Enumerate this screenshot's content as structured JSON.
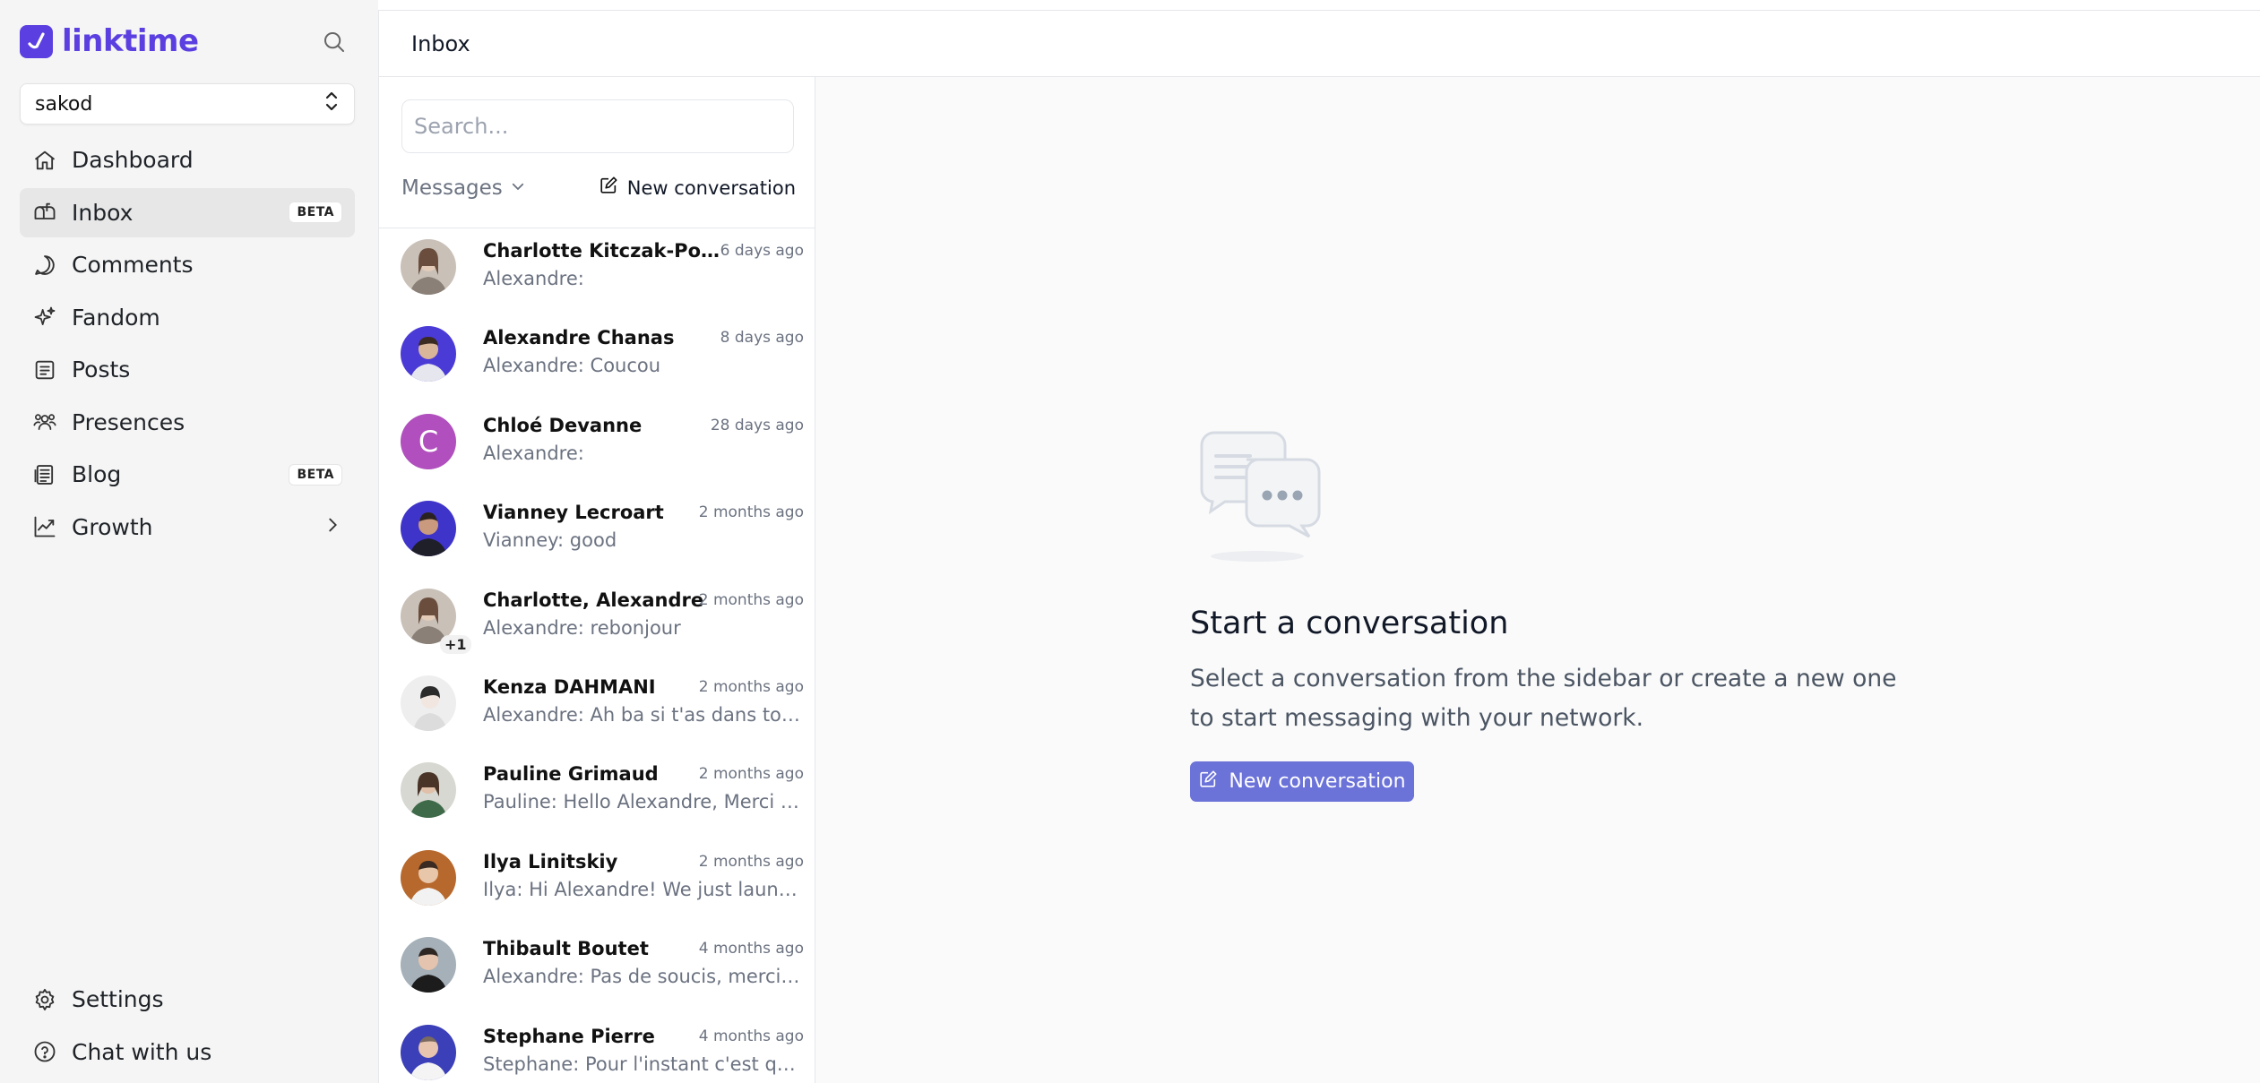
{
  "brand": {
    "name": "linktime",
    "accent": "#5b3fe0"
  },
  "workspace": {
    "selected": "sakod"
  },
  "nav": {
    "items": [
      {
        "label": "Dashboard",
        "icon": "home-icon"
      },
      {
        "label": "Inbox",
        "icon": "mailbox-icon",
        "badge": "BETA",
        "active": true
      },
      {
        "label": "Comments",
        "icon": "chat-bubble-icon"
      },
      {
        "label": "Fandom",
        "icon": "sparkles-icon"
      },
      {
        "label": "Posts",
        "icon": "document-list-icon"
      },
      {
        "label": "Presences",
        "icon": "users-icon"
      },
      {
        "label": "Blog",
        "icon": "newspaper-icon",
        "badge": "BETA"
      },
      {
        "label": "Growth",
        "icon": "trend-chart-icon",
        "has_submenu": true
      }
    ],
    "bottom": [
      {
        "label": "Settings",
        "icon": "gear-icon"
      },
      {
        "label": "Chat with us",
        "icon": "question-circle-icon"
      }
    ]
  },
  "header": {
    "title": "Inbox"
  },
  "conversations": {
    "search_placeholder": "Search...",
    "filter_label": "Messages",
    "new_label": "New conversation",
    "items": [
      {
        "name": "Charlotte Kitczak-Poplo...",
        "time": "6 days ago",
        "preview": "Alexandre:",
        "avatar_color": "#b7aca4"
      },
      {
        "name": "Alexandre Chanas",
        "time": "8 days ago",
        "preview": "Alexandre: Coucou",
        "avatar_color": "#4b3bd6"
      },
      {
        "name": "Chloé Devanne",
        "time": "28 days ago",
        "preview": "Alexandre:",
        "initial": "C",
        "avatar_color": "#b04fbd"
      },
      {
        "name": "Vianney Lecroart",
        "time": "2 months ago",
        "preview": "Vianney: good",
        "avatar_color": "#3e34c9"
      },
      {
        "name": "Charlotte, Alexandre",
        "time": "2 months ago",
        "preview": "Alexandre: rebonjour",
        "extra": "+1",
        "avatar_color": "#b7aca4"
      },
      {
        "name": "Kenza DAHMANI",
        "time": "2 months ago",
        "preview": "Alexandre: Ah ba si t'as dans ton ré...",
        "avatar_color": "#e9e9e9"
      },
      {
        "name": "Pauline Grimaud",
        "time": "2 months ago",
        "preview": "Pauline: Hello Alexandre, Merci pou...",
        "avatar_color": "#4d6a50"
      },
      {
        "name": "Ilya Linitskiy",
        "time": "2 months ago",
        "preview": "Ilya: Hi Alexandre! We just launche...",
        "avatar_color": "#b7682c"
      },
      {
        "name": "Thibault Boutet",
        "time": "4 months ago",
        "preview": "Alexandre: Pas de soucis, merci d'a...",
        "avatar_color": "#8d9aa4"
      },
      {
        "name": "Stephane Pierre",
        "time": "4 months ago",
        "preview": "Stephane: Pour l'instant c'est que le...",
        "avatar_color": "#3b3fb8"
      }
    ]
  },
  "empty_state": {
    "title": "Start a conversation",
    "description": "Select a conversation from the sidebar or create a new one to start messaging with your network.",
    "button_label": "New conversation",
    "button_color": "#6b72d8"
  }
}
